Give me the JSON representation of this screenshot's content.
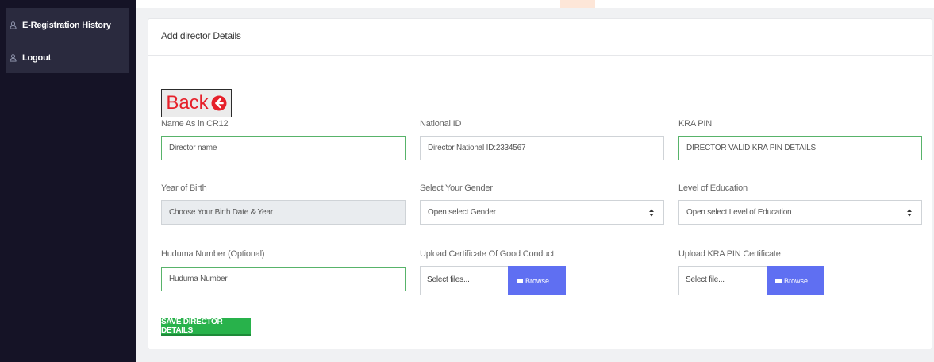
{
  "sidebar": {
    "items": [
      {
        "label": "E-Registration History",
        "icon": "user-icon"
      },
      {
        "label": "Logout",
        "icon": "user-icon"
      }
    ]
  },
  "card": {
    "title": "Add director Details"
  },
  "back_button": {
    "label": "Back",
    "icon": "arrow-left-circle-icon",
    "color": "#e6202a"
  },
  "form": {
    "name": {
      "label": "Name As in CR12",
      "placeholder": "Director name"
    },
    "national_id": {
      "label": "National ID",
      "placeholder": "Director National ID:2334567"
    },
    "kra_pin": {
      "label": "KRA PIN",
      "placeholder": "DIRECTOR VALID KRA PIN DETAILS"
    },
    "year_of_birth": {
      "label": "Year of Birth",
      "placeholder": "Choose Your Birth Date & Year"
    },
    "gender": {
      "label": "Select Your Gender",
      "selected": "Open select Gender"
    },
    "education": {
      "label": "Level of Education",
      "selected": "Open select Level of Education"
    },
    "huduma": {
      "label": "Huduma Number (Optional)",
      "placeholder": "Huduma Number"
    },
    "good_conduct": {
      "label": "Upload Certificate Of Good Conduct",
      "file_text": "Select files...",
      "browse_label": "Browse ..."
    },
    "kra_certificate": {
      "label": "Upload KRA PIN Certificate",
      "file_text": "Select file...",
      "browse_label": "Browse ..."
    }
  },
  "save_button": {
    "label": "SAVE DIRECTOR DETAILS",
    "color": "#28b24b"
  },
  "colors": {
    "sidebar_bg": "#151326",
    "accent": "#5f6ff2",
    "valid_border": "#58b36a"
  }
}
